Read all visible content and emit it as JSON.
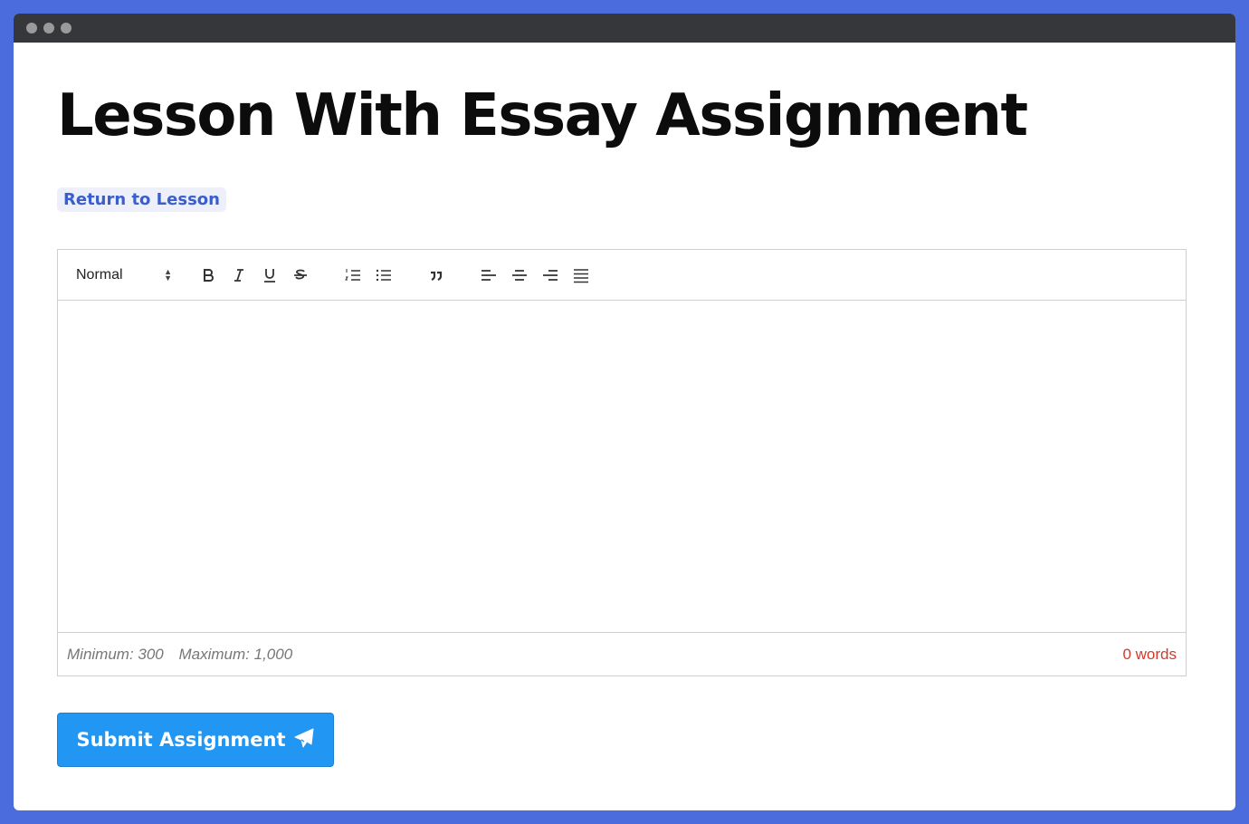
{
  "page": {
    "title": "Lesson With Essay Assignment",
    "return_link": "Return to Lesson"
  },
  "editor": {
    "format_selected": "Normal",
    "toolbar_icons": [
      "bold-icon",
      "italic-icon",
      "underline-icon",
      "strikethrough-icon",
      "ordered-list-icon",
      "bullet-list-icon",
      "blockquote-icon",
      "align-left-icon",
      "align-center-icon",
      "align-right-icon",
      "align-justify-icon"
    ],
    "body": ""
  },
  "footer": {
    "minimum": "Minimum: 300",
    "maximum": "Maximum: 1,000",
    "word_count": "0 words"
  },
  "submit": {
    "label": "Submit Assignment",
    "icon": "paper-plane-icon"
  },
  "colors": {
    "background": "#4a6cdc",
    "link": "#3a5fcd",
    "submit": "#2196f3",
    "word_count": "#d43a2a"
  }
}
